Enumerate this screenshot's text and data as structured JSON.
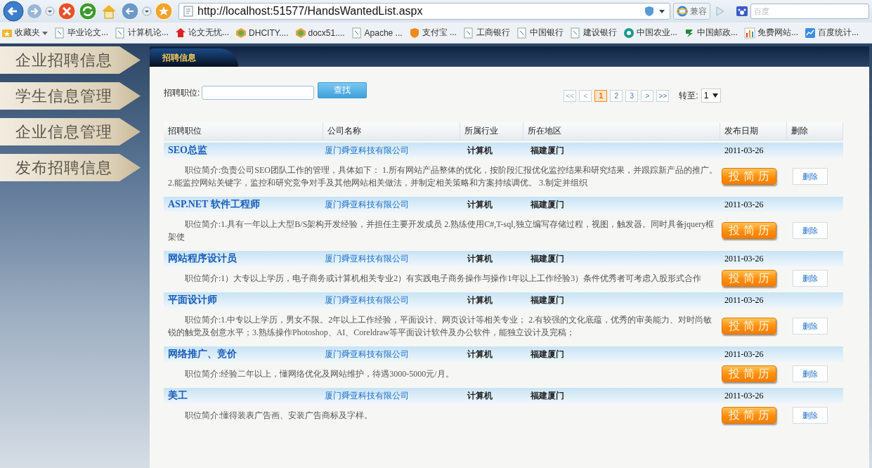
{
  "browser": {
    "address": "http://localhost:51577/HandsWantedList.aspx",
    "compat_label": "兼容",
    "search_placeholder": "百度"
  },
  "bookmarks": [
    {
      "label": "收藏夹",
      "kind": "folder"
    },
    {
      "label": "毕业论文...",
      "kind": "page"
    },
    {
      "label": "计算机论...",
      "kind": "page"
    },
    {
      "label": "论文无忧...",
      "kind": "red"
    },
    {
      "label": "DHCITY....",
      "kind": "hex"
    },
    {
      "label": "docx51....",
      "kind": "hex"
    },
    {
      "label": "Apache ...",
      "kind": "page"
    },
    {
      "label": "支付宝 ...",
      "kind": "shield"
    },
    {
      "label": "工商银行",
      "kind": "page"
    },
    {
      "label": "中国银行",
      "kind": "page"
    },
    {
      "label": "建设银行",
      "kind": "page"
    },
    {
      "label": "中国农业...",
      "kind": "coin"
    },
    {
      "label": "中国邮政...",
      "kind": "green"
    },
    {
      "label": "免费网站...",
      "kind": "bars"
    },
    {
      "label": "百度统计...",
      "kind": "chart"
    }
  ],
  "sidebar": {
    "items": [
      {
        "label": "企业招聘信息"
      },
      {
        "label": "学生信息管理"
      },
      {
        "label": "企业信息管理"
      },
      {
        "label": "发布招聘信息"
      }
    ]
  },
  "panel": {
    "title": "招聘信息",
    "search": {
      "label": "招聘职位:",
      "button": "查找"
    },
    "pagination": {
      "first": "<<",
      "prev": "<",
      "pages": [
        {
          "label": "1",
          "selected": true
        },
        {
          "label": "2",
          "selected": false
        },
        {
          "label": "3",
          "selected": false
        }
      ],
      "next": ">",
      "last": ">>",
      "goto_label": "转至:",
      "goto_value": "1"
    },
    "table": {
      "columns": [
        "招聘职位",
        "公司名称",
        "所属行业",
        "所在地区",
        "发布日期",
        "删除"
      ],
      "rows": [
        {
          "title": "SEO总监",
          "company": "厦门舜亚科技有限公司",
          "industry": "计算机",
          "location": "福建厦门",
          "date": "2011-03-26",
          "summary": "职位简介:负责公司SEO团队工作的管理，具体如下：  1.所有网站产品整体的优化，按阶段汇报优化监控结果和研究结果，并跟踪新产品的推广。  2.能监控网站关键字，监控和研究竞争对手及其他网站相关做法，并制定相关策略和方案持续调优。  3.制定并组织",
          "apply": "投简历",
          "delete": "删除"
        },
        {
          "title": "ASP.NET 软件工程师",
          "company": "厦门舜亚科技有限公司",
          "industry": "计算机",
          "location": "福建厦门",
          "date": "2011-03-26",
          "summary": "职位简介:1.具有一年以上大型B/S架构开发经验，并担任主要开发成员  2.熟练使用C#,T-sql,独立编写存储过程，视图，触发器。同时具备jquery框架使",
          "apply": "投简历",
          "delete": "删除"
        },
        {
          "title": "网站程序设计员",
          "company": "厦门舜亚科技有限公司",
          "industry": "计算机",
          "location": "福建厦门",
          "date": "2011-03-26",
          "summary": "职位简介:1）大专以上学历，电子商务或计算机相关专业2）有实践电子商务操作与操作1年以上工作经验3）条件优秀者可考虑入股形式合作",
          "apply": "投简历",
          "delete": "删除"
        },
        {
          "title": "平面设计师",
          "company": "厦门舜亚科技有限公司",
          "industry": "计算机",
          "location": "福建厦门",
          "date": "2011-03-26",
          "summary": "职位简介:1.中专以上学历，男女不限。2年以上工作经验，平面设计、网页设计等相关专业；  2.有较强的文化底蕴，优秀的审美能力、对时尚敏锐的触觉及创意水平；3.熟练操作Photoshop、AI、Coreldraw等平面设计软件及办公软件，能独立设计及完稿；",
          "apply": "投简历",
          "delete": "删除"
        },
        {
          "title": "网络推广、竞价",
          "company": "厦门舜亚科技有限公司",
          "industry": "计算机",
          "location": "福建厦门",
          "date": "2011-03-26",
          "summary": "职位简介:经验二年以上，懂网络优化及网站维护，待遇3000-5000元/月。",
          "apply": "投简历",
          "delete": "删除"
        },
        {
          "title": "美工",
          "company": "厦门舜亚科技有限公司",
          "industry": "计算机",
          "location": "福建厦门",
          "date": "2011-03-26",
          "summary": "职位简介:懂得装表广告画、安装广告商标及字样。",
          "apply": "投简历",
          "delete": "删除"
        }
      ]
    }
  }
}
